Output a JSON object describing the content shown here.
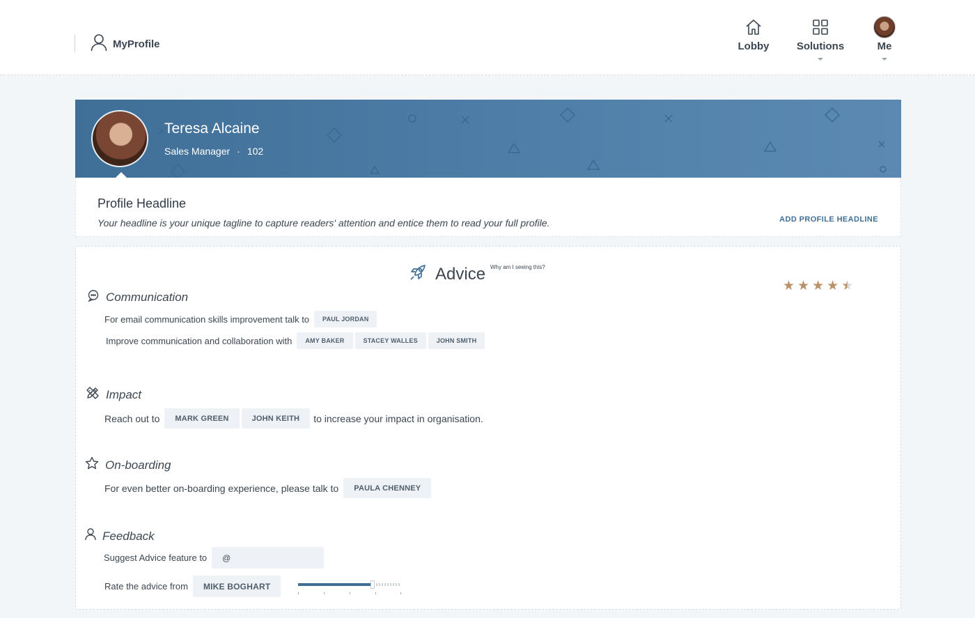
{
  "header": {
    "app_title": "MyProfile",
    "nav": [
      {
        "label": "Lobby",
        "icon": "home-icon"
      },
      {
        "label": "Solutions",
        "icon": "grid-icon"
      },
      {
        "label": "Me",
        "icon": "avatar"
      }
    ]
  },
  "profile": {
    "name": "Teresa Alcaine",
    "role": "Sales Manager",
    "separator": "·",
    "number": "102"
  },
  "headline": {
    "title": "Profile Headline",
    "description": "Your headline is your unique tagline to capture readers' attention and entice them to read your full profile.",
    "action_label": "ADD PROFILE HEADLINE"
  },
  "advice": {
    "title": "Advice",
    "why_link": "Why am I seeing this?",
    "rating": {
      "value": 4.5,
      "max": 5,
      "glyph": "★"
    },
    "communication": {
      "title": "Communication",
      "row1_text": "For email communication skills improvement talk to",
      "row1_people": [
        "PAUL JORDAN"
      ],
      "row2_text": "Improve communication and collaboration with",
      "row2_people": [
        "AMY BAKER",
        "STACEY WALLES",
        "JOHN SMITH"
      ]
    },
    "impact": {
      "title": "Impact",
      "before_text": "Reach out to",
      "people": [
        "MARK GREEN",
        "JOHN KEITH"
      ],
      "after_text": "to increase your impact in organisation."
    },
    "onboarding": {
      "title": "On-boarding",
      "text": "For even better on-boarding experience, please talk to",
      "people": [
        "PAULA CHENNEY"
      ]
    },
    "feedback": {
      "title": "Feedback",
      "suggest_text": "Suggest Advice feature to",
      "suggest_value": "@",
      "rate_text": "Rate the advice from",
      "rate_person": "MIKE BOGHART",
      "rate_level": 0.72
    }
  },
  "colors": {
    "accent": "#3f6f97",
    "banner": "#4f7fa8",
    "star": "#b9926a",
    "chip_bg": "#eef2f6"
  }
}
